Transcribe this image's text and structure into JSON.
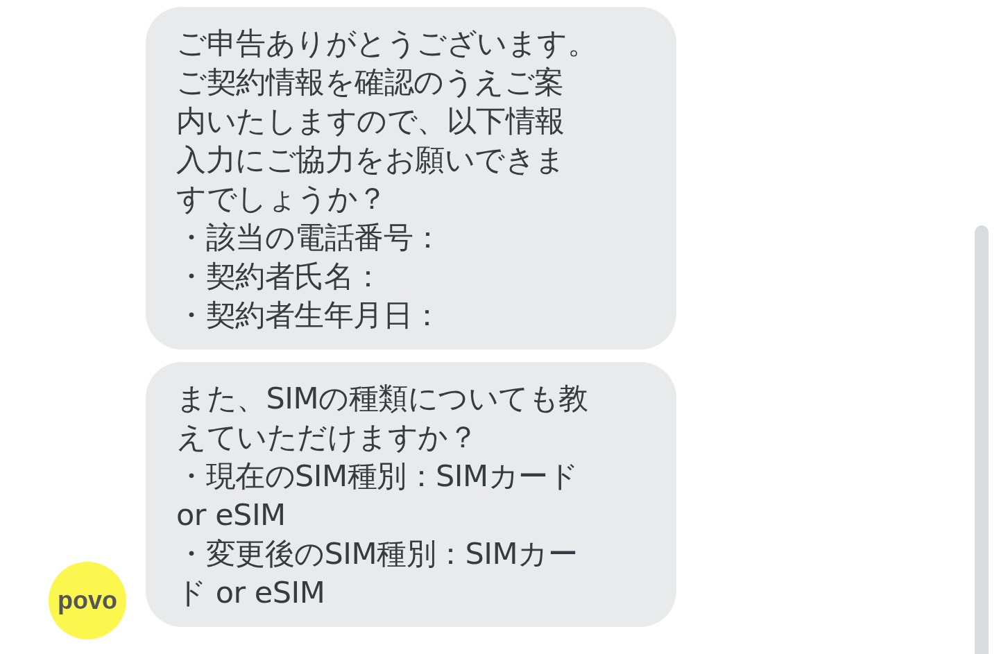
{
  "messages": [
    {
      "lines": [
        "ご申告ありがとうございます。",
        "ご契約情報を確認のうえご案",
        "内いたしますので、以下情報",
        "入力にご協力をお願いできま",
        "すでしょうか？",
        "・該当の電話番号：",
        "・契約者氏名：",
        "・契約者生年月日："
      ]
    },
    {
      "lines": [
        "また、SIMの種類についても教",
        "えていただけますか？",
        "・現在のSIM種別：SIMカード",
        "or eSIM",
        "・変更後のSIM種別：SIMカー",
        "ド or eSIM"
      ]
    }
  ],
  "avatar": {
    "label": "povo"
  }
}
